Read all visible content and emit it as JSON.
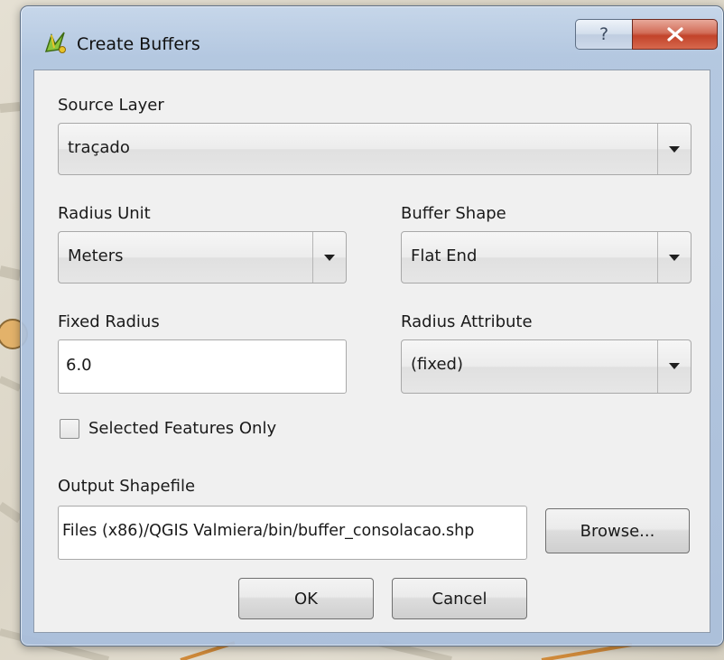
{
  "window": {
    "title": "Create Buffers",
    "help_glyph": "?",
    "close_glyph": "X"
  },
  "form": {
    "source_layer": {
      "label": "Source Layer",
      "value": "traçado"
    },
    "radius_unit": {
      "label": "Radius Unit",
      "value": "Meters"
    },
    "buffer_shape": {
      "label": "Buffer Shape",
      "value": "Flat End"
    },
    "fixed_radius": {
      "label": "Fixed Radius",
      "value": "6.0"
    },
    "radius_attribute": {
      "label": "Radius Attribute",
      "value": "(fixed)"
    },
    "selected_only": {
      "label": "Selected Features Only",
      "checked": false
    },
    "output_shapefile": {
      "label": "Output Shapefile",
      "value": "Files (x86)/QGIS Valmiera/bin/buffer_consolacao.shp",
      "browse_label": "Browse..."
    }
  },
  "buttons": {
    "ok": "OK",
    "cancel": "Cancel"
  },
  "icons": {
    "app": "qgis-icon",
    "help": "help-icon",
    "close": "close-icon",
    "dropdown": "chevron-down-icon"
  },
  "colors": {
    "client_bg": "#f0f0f0",
    "close_button": "#c2432a",
    "frame": "#b0c6e2"
  }
}
